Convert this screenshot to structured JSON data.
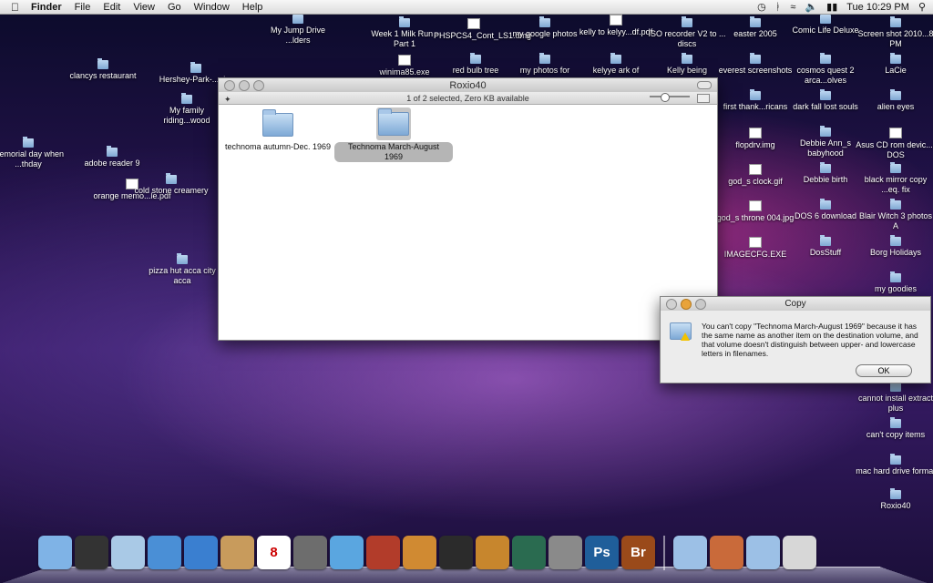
{
  "menubar": {
    "app": "Finder",
    "menus": [
      "File",
      "Edit",
      "View",
      "Go",
      "Window",
      "Help"
    ],
    "clock": "Tue 10:29 PM"
  },
  "desktop_icons": [
    {
      "label": "My Jump Drive ...lders"
    },
    {
      "label": "clancys restaurant"
    },
    {
      "label": "Hershey-Park-...nia-"
    },
    {
      "label": "My family riding...wood"
    },
    {
      "label": "memorial day when ...thday"
    },
    {
      "label": "adobe reader 9"
    },
    {
      "label": "orange memo...le.pdf"
    },
    {
      "label": "cold stone creamery"
    },
    {
      "label": "pizza hut acca city acca"
    },
    {
      "label": "Week 1 Milk Run - Part 1"
    },
    {
      "label": "PHSPCS4_Cont_LS1.dmg"
    },
    {
      "label": "my google photos"
    },
    {
      "label": "kelly to kelyy...df.pdf"
    },
    {
      "label": "ISO recorder V2 to ... discs"
    },
    {
      "label": "easter 2005"
    },
    {
      "label": "Comic Life Deluxe"
    },
    {
      "label": "Screen shot 2010...8 PM"
    },
    {
      "label": "winima85.exe"
    },
    {
      "label": "red bulb tree"
    },
    {
      "label": "my photos for"
    },
    {
      "label": "kelyye ark of"
    },
    {
      "label": "Kelly being"
    },
    {
      "label": "everest screenshots"
    },
    {
      "label": "cosmos quest 2 arca...olves"
    },
    {
      "label": "LaCie"
    },
    {
      "label": "first thank...ricans"
    },
    {
      "label": "dark fall lost souls"
    },
    {
      "label": "alien eyes"
    },
    {
      "label": "flopdrv.img"
    },
    {
      "label": "Debbie Ann_s babyhood"
    },
    {
      "label": "Asus CD rom devic...r DOS"
    },
    {
      "label": "god_s clock.gif"
    },
    {
      "label": "Debbie birth"
    },
    {
      "label": "black mirror copy ...eq. fix"
    },
    {
      "label": "god_s throne 004.jpg"
    },
    {
      "label": "DOS 6 download"
    },
    {
      "label": "Blair Witch 3 photos A"
    },
    {
      "label": "IMAGECFG.EXE"
    },
    {
      "label": "DosStuff"
    },
    {
      "label": "Borg Holidays"
    },
    {
      "label": "my goodies"
    },
    {
      "label": "cannot install extract plus"
    },
    {
      "label": "can't copy items"
    },
    {
      "label": "mac hard drive format"
    },
    {
      "label": "Roxio40"
    }
  ],
  "finder": {
    "title": "Roxio40",
    "status": "1 of 2 selected, Zero KB available",
    "items": [
      {
        "label": "technoma autumn-Dec. 1969",
        "selected": false
      },
      {
        "label": "Technoma March-August 1969",
        "selected": true
      }
    ]
  },
  "dialog": {
    "title": "Copy",
    "message": "You can't copy \"Technoma March-August 1969\" because it has the same name as another item on the destination volume, and that volume doesn't distinguish between upper- and lowercase letters in filenames.",
    "ok_label": "OK"
  },
  "dock": {
    "apps": [
      {
        "icon": "finder-icon",
        "color": "#7fb3e6"
      },
      {
        "icon": "dashboard-icon",
        "color": "#333333"
      },
      {
        "icon": "mail-icon",
        "color": "#a9c9e6"
      },
      {
        "icon": "safari-icon",
        "color": "#4a8fd6"
      },
      {
        "icon": "ichat-icon",
        "color": "#3a7fd0"
      },
      {
        "icon": "address-book-icon",
        "color": "#c89b5c"
      },
      {
        "icon": "ical-icon",
        "color": "#ffffff",
        "text": "8"
      },
      {
        "icon": "preview-icon",
        "color": "#6d6d6d"
      },
      {
        "icon": "itunes-icon",
        "color": "#5aa6e0"
      },
      {
        "icon": "photo-booth-icon",
        "color": "#b23c2a"
      },
      {
        "icon": "iphoto-icon",
        "color": "#d08a32"
      },
      {
        "icon": "imovie-icon",
        "color": "#2b2b2b"
      },
      {
        "icon": "garageband-icon",
        "color": "#c7862d"
      },
      {
        "icon": "time-machine-icon",
        "color": "#2a6b50"
      },
      {
        "icon": "system-preferences-icon",
        "color": "#8a8a8a"
      },
      {
        "icon": "photoshop-icon",
        "color": "#1f5e9a",
        "text": "Ps"
      },
      {
        "icon": "bridge-icon",
        "color": "#9a4a1a",
        "text": "Br"
      }
    ],
    "right": [
      {
        "icon": "applications-folder-icon",
        "color": "#9cc0e6"
      },
      {
        "icon": "documents-stack-icon",
        "color": "#c96a3a"
      },
      {
        "icon": "documents-folder-icon",
        "color": "#9cc0e6"
      },
      {
        "icon": "trash-icon",
        "color": "#d7d7d7"
      }
    ]
  }
}
